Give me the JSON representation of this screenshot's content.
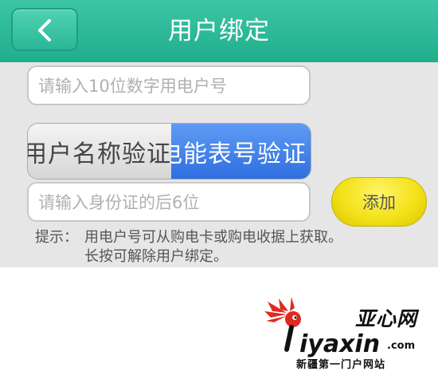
{
  "header": {
    "title": "用户绑定",
    "back_icon": "chevron-left-icon"
  },
  "form": {
    "account_placeholder": "请输入10位数字用电户号",
    "verify_tabs": [
      {
        "label": "用户名称验证",
        "selected": false
      },
      {
        "label": "电能表号验证",
        "selected": true
      }
    ],
    "id_placeholder": "请输入身份证的后6位",
    "add_label": "添加"
  },
  "hint": {
    "prefix": "提示：",
    "line1": "用电户号可从购电卡或购电收据上获取。",
    "line2": "长按可解除用户绑定。"
  },
  "watermark": {
    "cn": "亚心网",
    "domain": "iyaxin",
    "tld": ".com",
    "tagline": "新疆第一门户网站"
  },
  "colors": {
    "header": "#22b190",
    "selected_tab": "#3a7ee8",
    "add_button": "#f2e01c",
    "content_bg": "#e6e6e6"
  }
}
